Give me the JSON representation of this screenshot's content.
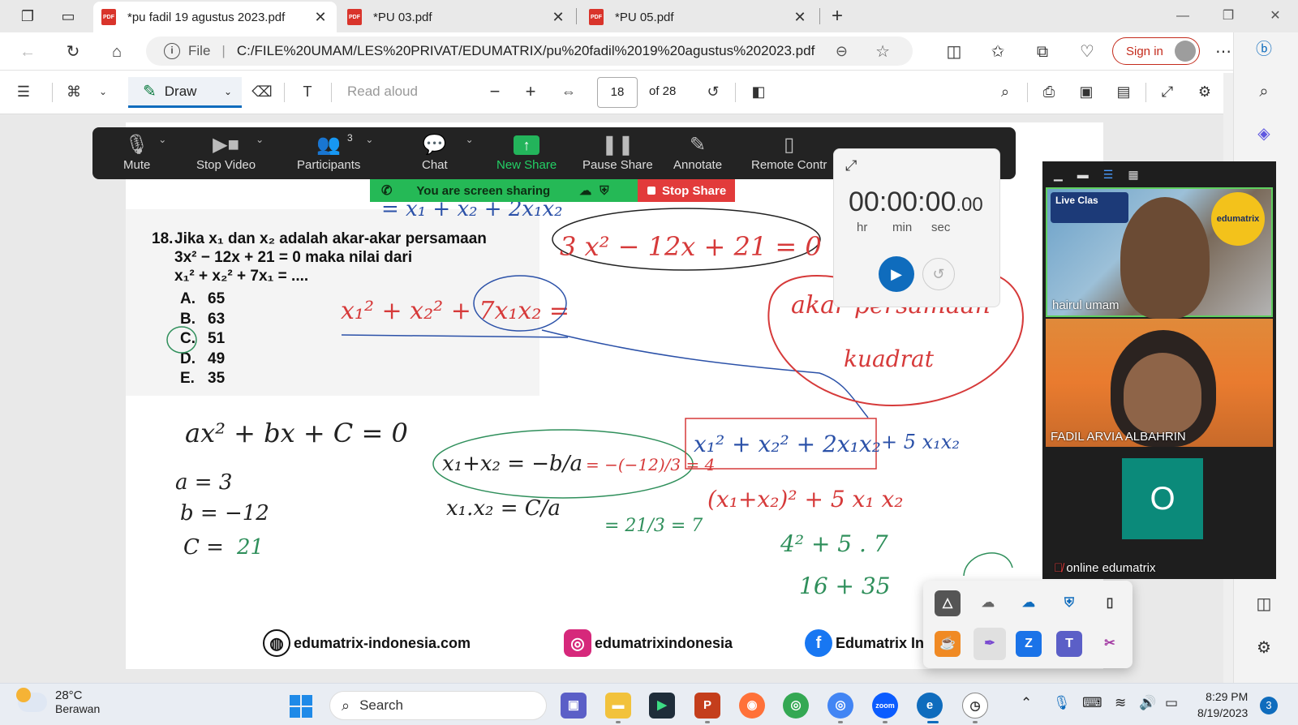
{
  "browser": {
    "tabs": [
      {
        "title": "*pu fadil 19 agustus 2023.pdf",
        "active": true
      },
      {
        "title": "*PU 03.pdf",
        "active": false
      },
      {
        "title": "*PU 05.pdf",
        "active": false
      }
    ],
    "address": {
      "scheme_label": "File",
      "url": "C:/FILE%20UMAM/LES%20PRIVAT/EDUMATRIX/pu%20fadil%2019%20agustus%202023.pdf"
    },
    "sign_in_label": "Sign in"
  },
  "pdf_toolbar": {
    "draw_label": "Draw",
    "read_aloud_label": "Read aloud",
    "current_page": "18",
    "total_pages_label": "of 28"
  },
  "zoom": {
    "toolbar": [
      {
        "key": "mute",
        "label": "Mute",
        "icon": "microphone-icon"
      },
      {
        "key": "video",
        "label": "Stop Video",
        "icon": "video-camera-icon"
      },
      {
        "key": "participants",
        "label": "Participants",
        "icon": "participants-icon",
        "count": "3"
      },
      {
        "key": "chat",
        "label": "Chat",
        "icon": "chat-bubble-icon"
      },
      {
        "key": "newshare",
        "label": "New Share",
        "icon": "share-up-arrow-icon"
      },
      {
        "key": "pause",
        "label": "Pause Share",
        "icon": "pause-icon"
      },
      {
        "key": "annotate",
        "label": "Annotate",
        "icon": "pencil-icon"
      },
      {
        "key": "remote",
        "label": "Remote Contr",
        "icon": "mouse-icon"
      }
    ],
    "sharing_banner": "You are screen sharing",
    "stop_share_label": "Stop Share",
    "participants": [
      {
        "name": "hairul umam",
        "video": true,
        "overlay_live": "Live Clas",
        "badge": "edumatrix"
      },
      {
        "name": "FADIL ARVIA ALBAHRIN",
        "video": true
      },
      {
        "name": "online edumatrix",
        "video": false,
        "avatar_letter": "O",
        "muted": true
      }
    ]
  },
  "stopwatch": {
    "time_main": "00:00:00",
    "time_fraction": ".00",
    "units": [
      "hr",
      "min",
      "sec"
    ]
  },
  "document": {
    "question_number": "18.",
    "question_line1": "Jika x₁ dan x₂ adalah akar-akar persamaan",
    "question_line2": "3x² − 12x + 21 = 0   maka   nilai   dari",
    "question_line3": "x₁² + x₂² + 7x₁ = ....",
    "options": [
      {
        "letter": "A.",
        "value": "65"
      },
      {
        "letter": "B.",
        "value": "63"
      },
      {
        "letter": "C.",
        "value": "51"
      },
      {
        "letter": "D.",
        "value": "49"
      },
      {
        "letter": "E.",
        "value": "35"
      }
    ],
    "footer": {
      "website": "edumatrix-indonesia.com",
      "instagram": "edumatrixindonesia",
      "facebook": "Edumatrix In"
    },
    "annotations": {
      "equation": "3 x² − 12x + 21 = 0",
      "target": "x₁² + x₂² + 7x₁x₂ =",
      "bubble": [
        "akar persamaan",
        "kuadrat"
      ],
      "general_form": "ax² + bx + C = 0",
      "a": "a = 3",
      "b": "b = −12",
      "c_label": "C = ",
      "c_value": "21",
      "sum": "x₁+x₂ = −b/a",
      "sum_calc": "= −(−12)/3 = 4",
      "product": "x₁.x₂ = C/a",
      "product_calc": "= 21/3 = 7",
      "expand": "x₁² + x₂² + 2x₁x₂",
      "expand_rest": "+ 5 x₁x₂",
      "square": "(x₁+x₂)² + 5 x₁ x₂",
      "subst": "4² + 5 . 7",
      "result": "16 + 35",
      "top_scribble": "= x₁ + x₂ + 2x₁x₂"
    }
  },
  "taskbar": {
    "weather_temp": "28°C",
    "weather_desc": "Berawan",
    "search_placeholder": "Search",
    "time": "8:29 PM",
    "date": "8/19/2023",
    "notification_count": "3"
  },
  "colors": {
    "accent": "#0f6cbd",
    "zoom_green": "#25b956",
    "stop_red": "#e23b3b",
    "ink_red": "#d63a3a",
    "ink_blue": "#2b51a8",
    "ink_green": "#2f8f5b"
  }
}
